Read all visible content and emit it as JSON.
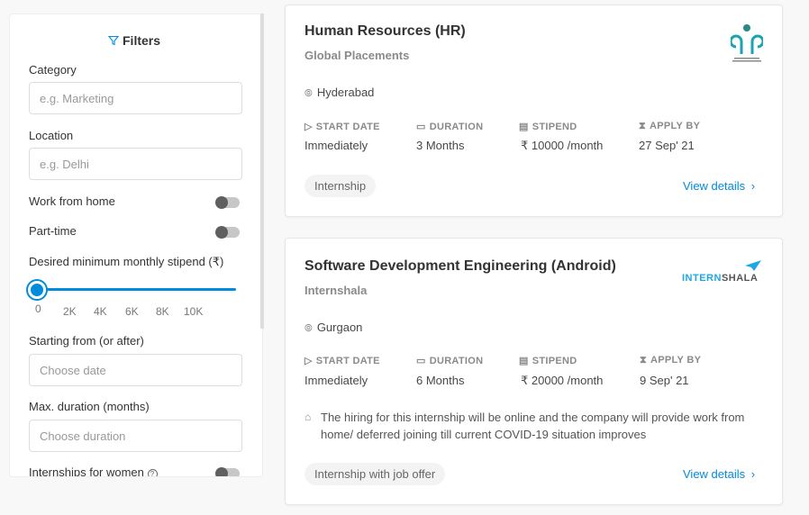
{
  "filters": {
    "title": "Filters",
    "category": {
      "label": "Category",
      "placeholder": "e.g. Marketing"
    },
    "location": {
      "label": "Location",
      "placeholder": "e.g. Delhi"
    },
    "work_from_home": {
      "label": "Work from home",
      "on": false
    },
    "part_time": {
      "label": "Part-time",
      "on": false
    },
    "stipend": {
      "label": "Desired minimum monthly stipend (₹)",
      "value": 0,
      "ticks": [
        "0",
        "2K",
        "4K",
        "6K",
        "8K",
        "10K"
      ]
    },
    "starting_from": {
      "label": "Starting from (or after)",
      "placeholder": "Choose date"
    },
    "max_duration": {
      "label": "Max. duration (months)",
      "placeholder": "Choose duration"
    },
    "women": {
      "label": "Internships for women",
      "on": false
    }
  },
  "colors": {
    "accent": "#008bdc"
  },
  "headers": {
    "start": "START DATE",
    "duration": "DURATION",
    "stipend": "STIPEND",
    "apply": "APPLY BY"
  },
  "cards": [
    {
      "title": "Human Resources (HR)",
      "company": "Global Placements",
      "logo_text": "GLOBAL PLACEMENTS",
      "location": "Hyderabad",
      "start": "Immediately",
      "duration": "3 Months",
      "stipend": "₹ 10000 /month",
      "apply_by": "27 Sep' 21",
      "tag": "Internship",
      "link": "View details"
    },
    {
      "title": "Software Development Engineering (Android)",
      "company": "Internshala",
      "logo_text": "INTERNSHALA",
      "location": "Gurgaon",
      "start": "Immediately",
      "duration": "6 Months",
      "stipend": "₹ 20000 /month",
      "apply_by": "9 Sep' 21",
      "note": "The hiring for this internship will be online and the company will provide work from home/ deferred joining till current COVID-19 situation improves",
      "tag": "Internship with job offer",
      "link": "View details"
    }
  ]
}
